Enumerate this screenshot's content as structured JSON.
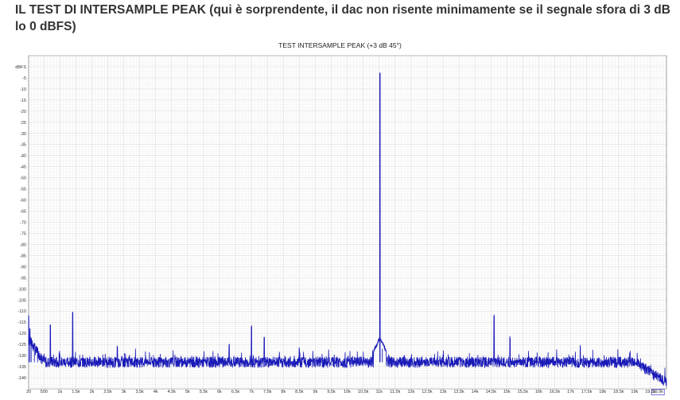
{
  "heading": {
    "line1": "IL TEST DI INTERSAMPLE PEAK (qui è sorprendente, il dac non risente minimamente se il segnale sfora di 3 dB",
    "line2": "lo 0 dBFS)"
  },
  "chart_data": {
    "type": "line",
    "title": "TEST INTERSAMPLE PEAK (+3 dB 45°)",
    "xlabel": "",
    "ylabel": "",
    "xlim": [
      20,
      20000
    ],
    "ylim": [
      -145,
      5
    ],
    "grid": true,
    "y_ticks": [
      "dBFS",
      "-5",
      "-10",
      "-15",
      "-20",
      "-25",
      "-30",
      "-35",
      "-40",
      "-45",
      "-50",
      "-55",
      "-60",
      "-65",
      "-70",
      "-75",
      "-80",
      "-85",
      "-90",
      "-95",
      "-100",
      "-105",
      "-110",
      "-115",
      "-120",
      "-125",
      "-130",
      "-135",
      "-140"
    ],
    "x_ticks": [
      "20",
      "500",
      "1k",
      "1,5k",
      "2k",
      "2,5k",
      "3k",
      "3,5k",
      "4k",
      "4,5k",
      "5k",
      "5,5k",
      "6k",
      "6,5k",
      "7k",
      "7,5k",
      "8k",
      "8,5k",
      "9k",
      "9,5k",
      "10k",
      "10,5k",
      "11k",
      "11,5k",
      "12k",
      "12,5k",
      "13k",
      "13,5k",
      "14k",
      "14,5k",
      "15k",
      "15,5k",
      "16k",
      "16,5k",
      "17k",
      "17,5k",
      "18k",
      "18,5k",
      "19k",
      "19,5k",
      "19,9k"
    ],
    "series": [
      {
        "color": "#1a1ab8",
        "noise_floor_db": -133,
        "points": [
          [
            20,
            -112
          ],
          [
            60,
            -118
          ],
          [
            100,
            -122
          ],
          [
            200,
            -125
          ],
          [
            300,
            -127
          ],
          [
            500,
            -130
          ],
          [
            700,
            -116
          ],
          [
            1000,
            -130
          ],
          [
            1400,
            -111
          ],
          [
            2000,
            -131
          ],
          [
            2800,
            -126
          ],
          [
            4000,
            -132
          ],
          [
            6300,
            -125
          ],
          [
            7000,
            -117
          ],
          [
            7400,
            -122
          ],
          [
            8500,
            -127
          ],
          [
            10000,
            -132
          ],
          [
            10800,
            -128
          ],
          [
            10950,
            -131
          ],
          [
            11025,
            -3
          ],
          [
            11100,
            -127
          ],
          [
            11300,
            -130
          ],
          [
            12000,
            -132
          ],
          [
            14000,
            -131
          ],
          [
            14600,
            -112
          ],
          [
            15100,
            -122
          ],
          [
            16000,
            -131
          ],
          [
            17300,
            -126
          ],
          [
            18000,
            -132
          ],
          [
            19000,
            -134
          ],
          [
            19500,
            -137
          ],
          [
            19950,
            -142
          ]
        ]
      }
    ]
  }
}
